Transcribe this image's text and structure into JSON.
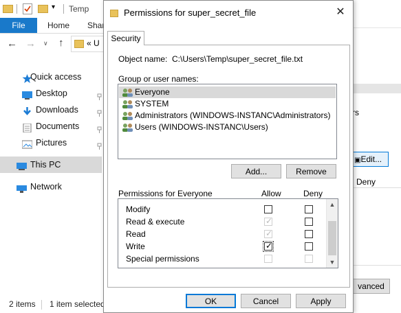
{
  "explorer": {
    "title": "Temp",
    "tabs": {
      "file": "File",
      "home": "Home",
      "share": "Shar"
    },
    "address_fragment": "« U",
    "nav": [
      {
        "label": "Quick access",
        "icon": "star-icon"
      },
      {
        "label": "Desktop",
        "icon": "desktop-icon"
      },
      {
        "label": "Downloads",
        "icon": "download-icon"
      },
      {
        "label": "Documents",
        "icon": "documents-icon"
      },
      {
        "label": "Pictures",
        "icon": "pictures-icon"
      },
      {
        "label": "This PC",
        "icon": "pc-icon"
      },
      {
        "label": "Network",
        "icon": "network-icon"
      }
    ],
    "status": {
      "items": "2 items",
      "selected": "1 item selected"
    }
  },
  "dialog": {
    "title": "Permissions for super_secret_file",
    "tab": "Security",
    "object_name_label": "Object name:",
    "object_name_value": "C:\\Users\\Temp\\super_secret_file.txt",
    "group_label": "Group or user names:",
    "groups": [
      {
        "name": "Everyone",
        "selected": true
      },
      {
        "name": "SYSTEM",
        "selected": false
      },
      {
        "name": "Administrators (WINDOWS-INSTANC\\Administrators)",
        "selected": false
      },
      {
        "name": "Users (WINDOWS-INSTANC\\Users)",
        "selected": false
      }
    ],
    "add_button": "Add...",
    "remove_button": "Remove",
    "perm_header": "Permissions for Everyone",
    "allow_header": "Allow",
    "deny_header": "Deny",
    "permissions": [
      {
        "name": "Modify",
        "allow": false,
        "allow_disabled": false,
        "deny": false,
        "deny_disabled": false
      },
      {
        "name": "Read & execute",
        "allow": true,
        "allow_disabled": true,
        "deny": false,
        "deny_disabled": false
      },
      {
        "name": "Read",
        "allow": true,
        "allow_disabled": true,
        "deny": false,
        "deny_disabled": false
      },
      {
        "name": "Write",
        "allow": true,
        "allow_disabled": false,
        "deny": false,
        "deny_disabled": false
      },
      {
        "name": "Special permissions",
        "allow": false,
        "allow_disabled": true,
        "deny": false,
        "deny_disabled": true
      }
    ],
    "ok_button": "OK",
    "cancel_button": "Cancel",
    "apply_button": "Apply"
  },
  "background_right": {
    "fragment_rs": "rs",
    "edit_button": "Edit...",
    "deny": "Deny",
    "advanced": "vanced"
  },
  "colors": {
    "accent": "#0078d7",
    "file_tab": "#1979ca",
    "selection": "#d9d9d9"
  }
}
